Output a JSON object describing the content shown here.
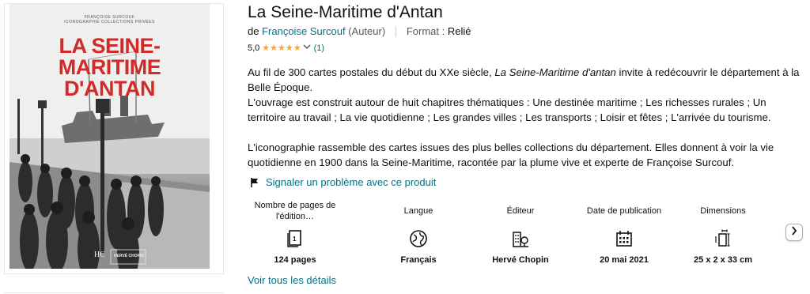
{
  "cover": {
    "subtitle_line1": "FRANÇOISE SURCOUF",
    "subtitle_line2": "ICONOGRAPHIE COLLECTIONS PRIVÉES",
    "title_line1": "LA SEINE-MARITIME",
    "title_line2": "D'ANTAN",
    "publisher_mark": "HC",
    "publisher_mark_text": "HERVÉ CHOPIN"
  },
  "product": {
    "title": "La Seine-Maritime d'Antan",
    "by_prefix": "de",
    "author": "Françoise Surcouf",
    "author_role": "(Auteur)",
    "format_label": "Format :",
    "format_value": "Relié",
    "rating_value": "5,0",
    "rating_stars": "★★★★★",
    "rating_count": "(1)"
  },
  "description": {
    "p1_before": "Au fil de 300 cartes postales du début du XXe siècle, ",
    "p1_italic": "La Seine-Maritime d'antan",
    "p1_after": " invite à redécouvrir le département à la Belle Époque.",
    "p2": "L'ouvrage est construit autour de huit chapitres thématiques : Une destinée maritime ; Les richesses rurales ; Un territoire au travail ; La vie quotidienne ; Les grandes villes ; Les transports ; Loisir et fêtes ; L'arrivée du tourisme.",
    "p3": "L'iconographie rassemble des cartes issues des plus belles collections du département. Elles donnent à voir la vie quotidienne en 1900 dans la Seine-Maritime, racontée par la plume vive et experte de Françoise Surcouf."
  },
  "report_link": "Signaler un problème avec ce produit",
  "details": [
    {
      "label": "Nombre de pages de l'édition…",
      "icon": "pages-icon",
      "value": "124 pages"
    },
    {
      "label": "Langue",
      "icon": "globe-icon",
      "value": "Français"
    },
    {
      "label": "Éditeur",
      "icon": "building-icon",
      "value": "Hervé Chopin"
    },
    {
      "label": "Date de publication",
      "icon": "calendar-icon",
      "value": "20 mai 2021"
    },
    {
      "label": "Dimensions",
      "icon": "dimensions-icon",
      "value": "25 x 2 x 33 cm"
    }
  ],
  "see_all_link": "Voir tous les détails",
  "colors": {
    "link": "#007185",
    "star": "#ffa41c",
    "cover_title": "#d12a2a"
  }
}
